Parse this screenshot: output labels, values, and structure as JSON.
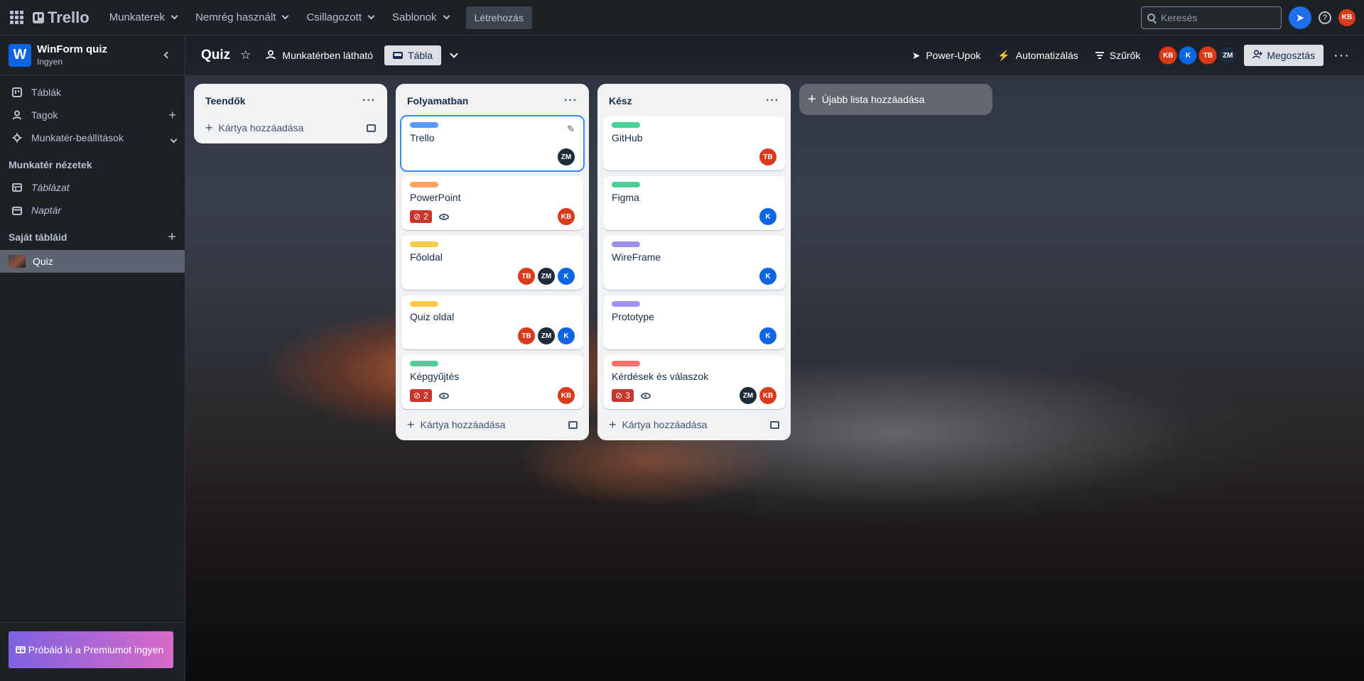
{
  "topnav": {
    "logo": "Trello",
    "menus": [
      "Munkaterek",
      "Nemrég használt",
      "Csillagozott",
      "Sablonok"
    ],
    "create": "Létrehozás",
    "search_placeholder": "Keresés",
    "user_initials": "KB"
  },
  "sidebar": {
    "workspace_letter": "W",
    "workspace_name": "WinForm quiz",
    "workspace_plan": "Ingyen",
    "items": [
      {
        "label": "Táblák",
        "icon": "board-icon"
      },
      {
        "label": "Tagok",
        "icon": "member-icon"
      },
      {
        "label": "Munkatér-beállítások",
        "icon": "gear-icon"
      }
    ],
    "views_heading": "Munkatér nézetek",
    "views": [
      "Táblázat",
      "Naptár"
    ],
    "boards_heading": "Saját tábláid",
    "boards": [
      "Quiz"
    ],
    "premium": "Próbáld ki a Premiumot ingyen"
  },
  "board": {
    "title": "Quiz",
    "visibility": "Munkatérben látható",
    "view": "Tábla",
    "power_ups": "Power-Upok",
    "automation": "Automatizálás",
    "filters": "Szűrők",
    "members": [
      {
        "initials": "KB",
        "cls": "av-kb"
      },
      {
        "initials": "K",
        "cls": "av-k"
      },
      {
        "initials": "TB",
        "cls": "av-tb"
      },
      {
        "initials": "ZM",
        "cls": "av-zm"
      }
    ],
    "share": "Megosztás",
    "add_list": "Újabb lista hozzáadása",
    "add_card": "Kártya hozzáadása"
  },
  "lists": [
    {
      "name": "Teendők",
      "cards": []
    },
    {
      "name": "Folyamatban",
      "cards": [
        {
          "title": "Trello",
          "label_color": "#579dff",
          "members": [
            "ZM"
          ],
          "editing": true
        },
        {
          "title": "PowerPoint",
          "label_color": "#fea362",
          "badge": "2",
          "watch": true,
          "members": [
            "KB"
          ]
        },
        {
          "title": "Főoldal",
          "label_color": "#f5cd47",
          "members": [
            "TB",
            "ZM",
            "K"
          ]
        },
        {
          "title": "Quiz oldal",
          "label_color": "#f5cd47",
          "members": [
            "TB",
            "ZM",
            "K"
          ]
        },
        {
          "title": "Képgyűjtés",
          "label_color": "#4bce97",
          "badge": "2",
          "watch": true,
          "members": [
            "KB"
          ]
        }
      ]
    },
    {
      "name": "Kész",
      "cards": [
        {
          "title": "GitHub",
          "label_color": "#4bce97",
          "members": [
            "TB"
          ]
        },
        {
          "title": "Figma",
          "label_color": "#4bce97",
          "members": [
            "K"
          ]
        },
        {
          "title": "WireFrame",
          "label_color": "#9f8fef",
          "members": [
            "K"
          ]
        },
        {
          "title": "Prototype",
          "label_color": "#9f8fef",
          "members": [
            "K"
          ]
        },
        {
          "title": "Kérdések és válaszok",
          "label_color": "#f87168",
          "badge": "3",
          "watch": true,
          "members": [
            "ZM",
            "KB"
          ]
        }
      ]
    }
  ]
}
